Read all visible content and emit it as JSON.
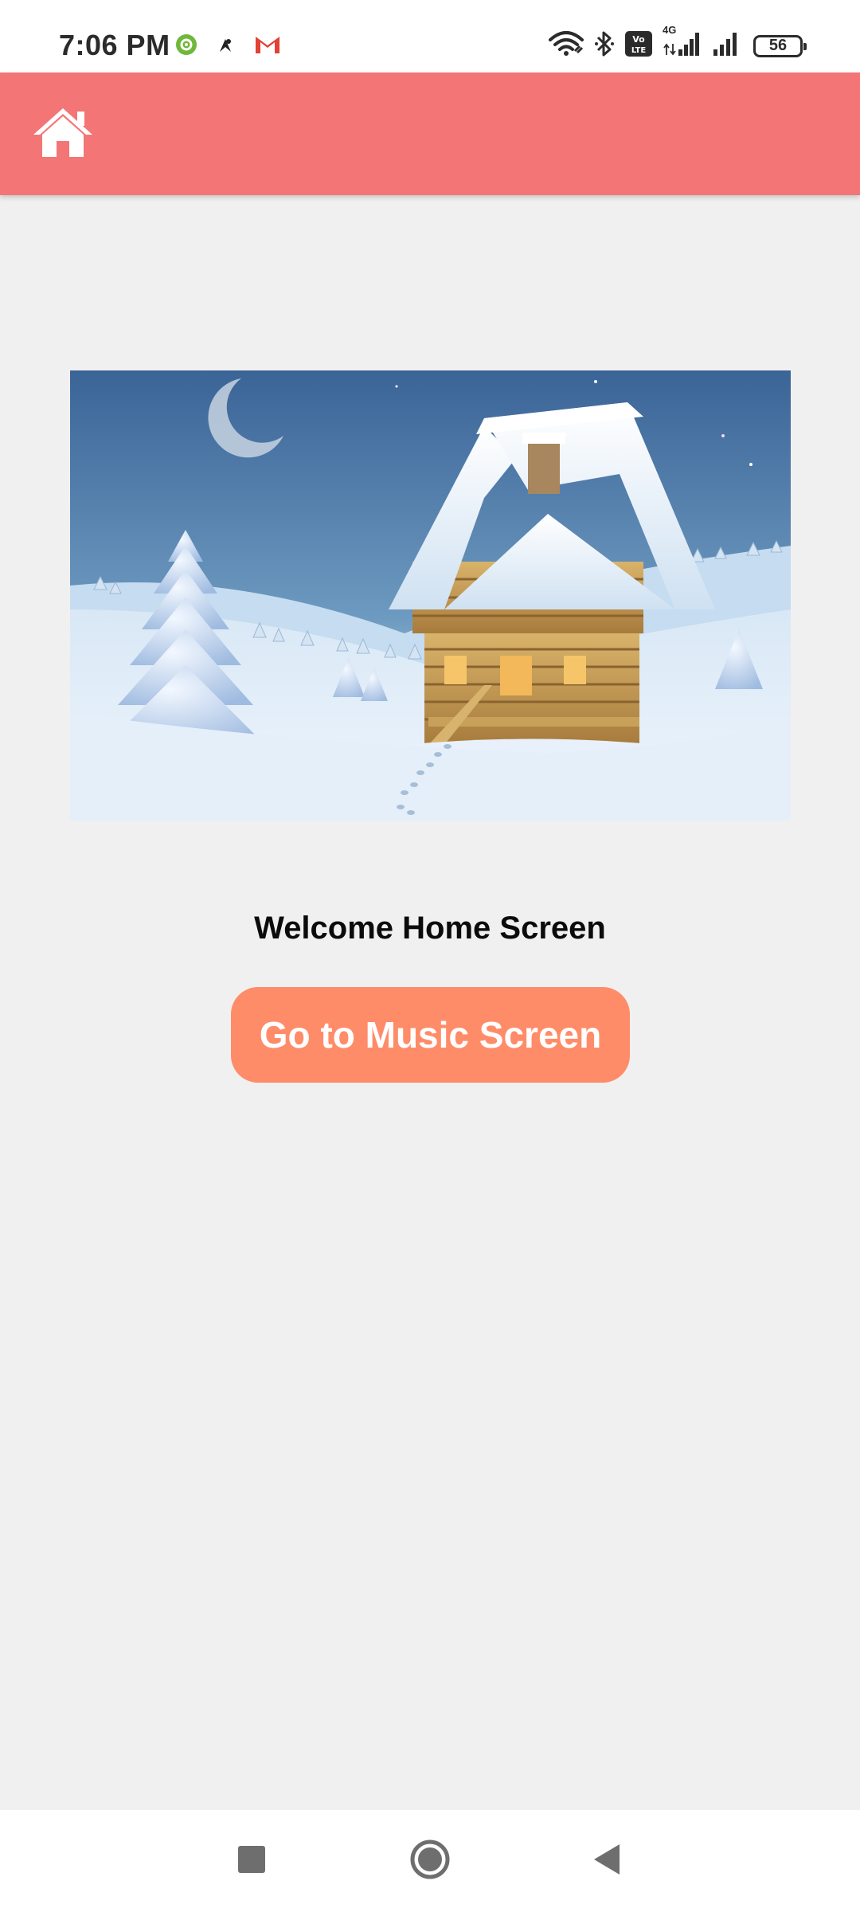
{
  "status_bar": {
    "time": "7:06 PM",
    "notification_icons": [
      "settings-badge-icon",
      "app-notification-icon",
      "gmail-icon"
    ],
    "system_icons": [
      "wifi-icon",
      "bluetooth-icon",
      "volte-icon",
      "signal-4g-icon",
      "signal-icon",
      "battery-icon"
    ],
    "network_type": "4G",
    "volte_label": "Vo LTE",
    "battery_level": "56"
  },
  "app_bar": {
    "color": "#f47575",
    "home_icon": "home-icon"
  },
  "hero_image": {
    "subject": "snowy-log-cabin-illustration"
  },
  "main": {
    "welcome_text": "Welcome Home Screen",
    "music_button_label": "Go to Music Screen",
    "button_color": "#ff8c69"
  },
  "nav_bar": {
    "items": [
      "recents-icon",
      "home-circle-icon",
      "back-icon"
    ]
  }
}
